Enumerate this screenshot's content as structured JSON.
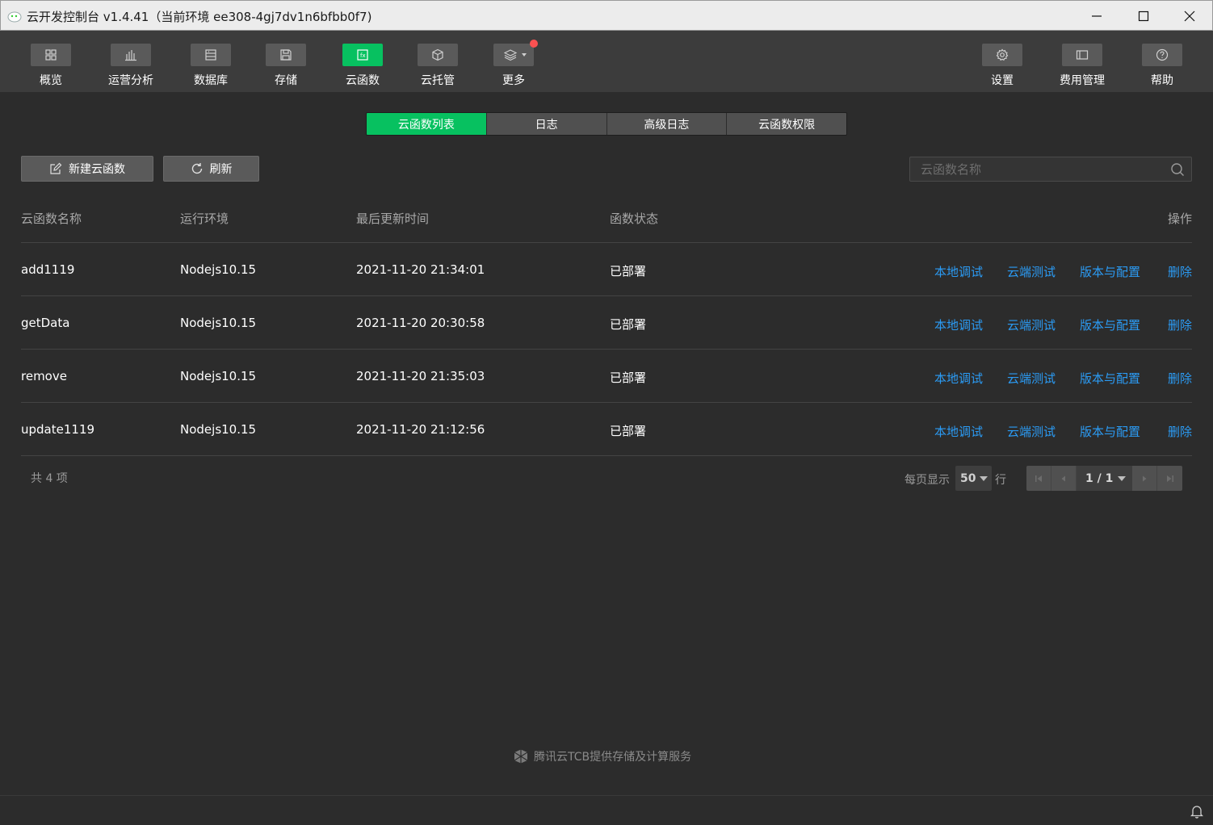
{
  "window": {
    "title": "云开发控制台 v1.4.41（当前环境 ee308-4gj7dv1n6bfbb0f7)"
  },
  "toolbar": {
    "left_items": [
      {
        "label": "概览",
        "icon": "grid-icon"
      },
      {
        "label": "运营分析",
        "icon": "bar-chart-icon"
      },
      {
        "label": "数据库",
        "icon": "database-icon"
      },
      {
        "label": "存储",
        "icon": "save-icon"
      },
      {
        "label": "云函数",
        "icon": "function-icon",
        "active": true
      },
      {
        "label": "云托管",
        "icon": "cube-icon"
      },
      {
        "label": "更多",
        "icon": "layers-icon",
        "badge": true
      }
    ],
    "right_items": [
      {
        "label": "设置",
        "icon": "gear-icon"
      },
      {
        "label": "费用管理",
        "icon": "billing-icon"
      },
      {
        "label": "帮助",
        "icon": "help-icon"
      }
    ]
  },
  "tabs": [
    "云函数列表",
    "日志",
    "高级日志",
    "云函数权限"
  ],
  "actions": {
    "new_label": "新建云函数",
    "refresh_label": "刷新"
  },
  "search": {
    "placeholder": "云函数名称",
    "value": ""
  },
  "table": {
    "headers": {
      "name": "云函数名称",
      "runtime": "运行环境",
      "updated": "最后更新时间",
      "status": "函数状态",
      "ops": "操作"
    },
    "rows": [
      {
        "name": "add1119",
        "runtime": "Nodejs10.15",
        "updated": "2021-11-20 21:34:01",
        "status": "已部署"
      },
      {
        "name": "getData",
        "runtime": "Nodejs10.15",
        "updated": "2021-11-20 20:30:58",
        "status": "已部署"
      },
      {
        "name": "remove",
        "runtime": "Nodejs10.15",
        "updated": "2021-11-20 21:35:03",
        "status": "已部署"
      },
      {
        "name": "update1119",
        "runtime": "Nodejs10.15",
        "updated": "2021-11-20 21:12:56",
        "status": "已部署"
      }
    ],
    "row_actions": {
      "local_debug": "本地调试",
      "cloud_test": "云端测试",
      "version_config": "版本与配置",
      "delete": "删除"
    }
  },
  "pagination": {
    "total_text": "共 4 项",
    "per_page_label": "每页显示",
    "per_page_value": "50",
    "row_unit": "行",
    "page_text": "1 / 1"
  },
  "footer": {
    "credit": "腾讯云TCB提供存储及计算服务"
  },
  "colors": {
    "accent": "#07c160",
    "link": "#2b9bf4",
    "badge": "#fa5151"
  }
}
